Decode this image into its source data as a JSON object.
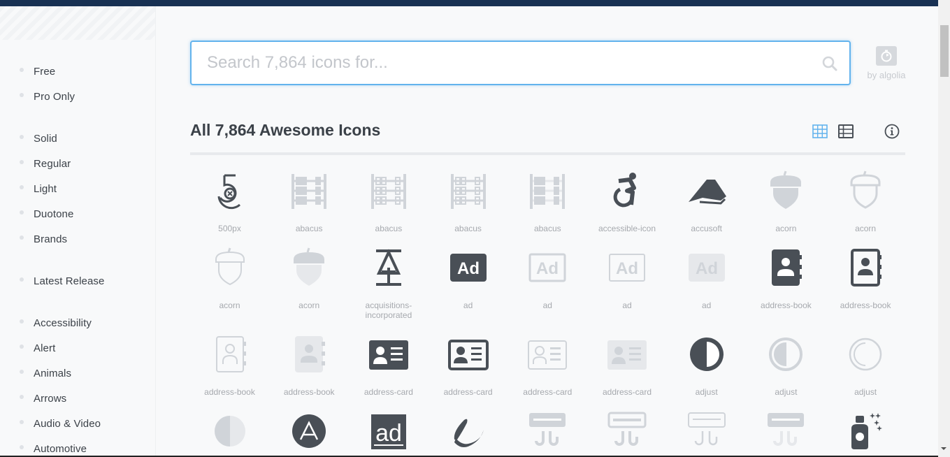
{
  "sidebar": {
    "groups": [
      {
        "items": [
          {
            "label": "Free"
          },
          {
            "label": "Pro Only"
          }
        ]
      },
      {
        "items": [
          {
            "label": "Solid"
          },
          {
            "label": "Regular"
          },
          {
            "label": "Light"
          },
          {
            "label": "Duotone"
          },
          {
            "label": "Brands"
          }
        ]
      },
      {
        "items": [
          {
            "label": "Latest Release"
          }
        ]
      },
      {
        "items": [
          {
            "label": "Accessibility"
          },
          {
            "label": "Alert"
          },
          {
            "label": "Animals"
          },
          {
            "label": "Arrows"
          },
          {
            "label": "Audio & Video"
          },
          {
            "label": "Automotive"
          }
        ]
      }
    ]
  },
  "search": {
    "placeholder": "Search 7,864 icons for...",
    "value": "",
    "icon": "search-icon",
    "powered_by": "by algolia",
    "powered_icon": "stopwatch-icon"
  },
  "main": {
    "heading": "All 7,864 Awesome Icons",
    "view_toggle": {
      "active": "grid",
      "grid_icon": "grid-view-icon",
      "table_icon": "table-view-icon"
    },
    "info_icon": "info-circle-icon",
    "accent_color": "#63b3ed",
    "icon_dark_color": "#494f56",
    "icon_light_color": "#d0d4d9",
    "icons": [
      {
        "name": "500px",
        "glyph": "500px",
        "style": "brand"
      },
      {
        "name": "abacus",
        "glyph": "abacus",
        "style": "solid"
      },
      {
        "name": "abacus",
        "glyph": "abacus",
        "style": "regular"
      },
      {
        "name": "abacus",
        "glyph": "abacus",
        "style": "light"
      },
      {
        "name": "abacus",
        "glyph": "abacus",
        "style": "duotone"
      },
      {
        "name": "accessible-icon",
        "glyph": "accessible",
        "style": "brand"
      },
      {
        "name": "accusoft",
        "glyph": "accusoft",
        "style": "brand"
      },
      {
        "name": "acorn",
        "glyph": "acorn",
        "style": "solid"
      },
      {
        "name": "acorn",
        "glyph": "acorn",
        "style": "regular"
      },
      {
        "name": "acorn",
        "glyph": "acorn",
        "style": "light"
      },
      {
        "name": "acorn",
        "glyph": "acorn",
        "style": "duotone"
      },
      {
        "name": "acquisitions-incorporated",
        "glyph": "acq",
        "style": "brand"
      },
      {
        "name": "ad",
        "glyph": "ad",
        "style": "solid-dark"
      },
      {
        "name": "ad",
        "glyph": "ad",
        "style": "regular"
      },
      {
        "name": "ad",
        "glyph": "ad",
        "style": "light"
      },
      {
        "name": "ad",
        "glyph": "ad",
        "style": "duotone"
      },
      {
        "name": "address-book",
        "glyph": "address-book",
        "style": "solid-dark"
      },
      {
        "name": "address-book",
        "glyph": "address-book",
        "style": "regular-dark"
      },
      {
        "name": "address-book",
        "glyph": "address-book",
        "style": "light"
      },
      {
        "name": "address-book",
        "glyph": "address-book",
        "style": "duotone"
      },
      {
        "name": "address-card",
        "glyph": "address-card",
        "style": "solid-dark"
      },
      {
        "name": "address-card",
        "glyph": "address-card",
        "style": "regular-dark"
      },
      {
        "name": "address-card",
        "glyph": "address-card",
        "style": "light"
      },
      {
        "name": "address-card",
        "glyph": "address-card",
        "style": "duotone"
      },
      {
        "name": "adjust",
        "glyph": "adjust",
        "style": "solid-dark"
      },
      {
        "name": "adjust",
        "glyph": "adjust",
        "style": "regular"
      },
      {
        "name": "adjust",
        "glyph": "adjust",
        "style": "light"
      },
      {
        "name": "",
        "glyph": "adjust",
        "style": "duotone"
      },
      {
        "name": "",
        "glyph": "adn",
        "style": "brand"
      },
      {
        "name": "",
        "glyph": "adversal",
        "style": "brand"
      },
      {
        "name": "",
        "glyph": "affiliatetheme",
        "style": "brand"
      },
      {
        "name": "",
        "glyph": "air-conditioner",
        "style": "solid"
      },
      {
        "name": "",
        "glyph": "air-conditioner",
        "style": "regular"
      },
      {
        "name": "",
        "glyph": "air-conditioner",
        "style": "light"
      },
      {
        "name": "",
        "glyph": "air-conditioner",
        "style": "duotone"
      },
      {
        "name": "",
        "glyph": "air-freshener",
        "style": "solid-dark"
      }
    ]
  }
}
